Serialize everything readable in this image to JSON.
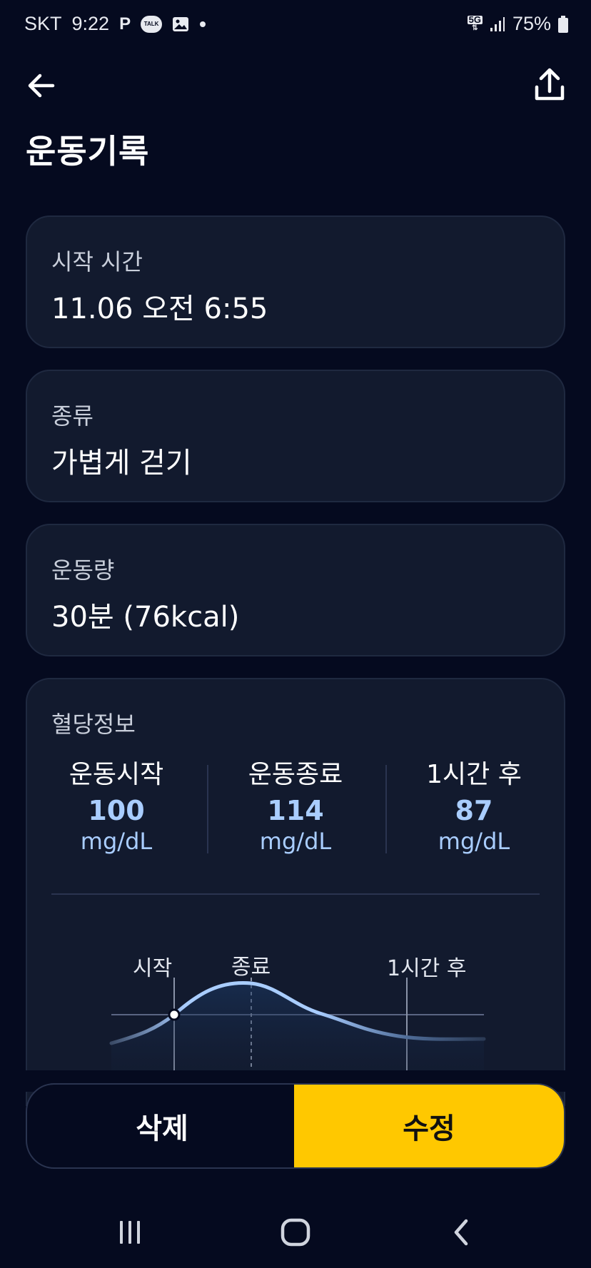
{
  "status_bar": {
    "carrier": "SKT",
    "time": "9:22",
    "p_icon_label": "P",
    "talk_label": "TALK",
    "network": "5G",
    "battery": "75%"
  },
  "header": {
    "title": "운동기록",
    "icons": {
      "back": "arrow-left-icon",
      "share": "share-upload-icon"
    }
  },
  "cards": {
    "start_time": {
      "label": "시작 시간",
      "value": "11.06 오전 6:55"
    },
    "type": {
      "label": "종류",
      "value": "가볍게 걷기"
    },
    "amount": {
      "label": "운동량",
      "value": "30분 (76kcal)"
    }
  },
  "blood_glucose": {
    "title": "혈당정보",
    "columns": [
      {
        "label": "운동시작",
        "value": "100",
        "unit": "mg/dL"
      },
      {
        "label": "운동종료",
        "value": "114",
        "unit": "mg/dL"
      },
      {
        "label": "1시간 후",
        "value": "87",
        "unit": "mg/dL"
      }
    ],
    "chart": {
      "markers": [
        "시작",
        "종료",
        "1시간 후"
      ],
      "line_color": "#a9cdff"
    }
  },
  "actions": {
    "delete_label": "삭제",
    "edit_label": "수정",
    "edit_color": "#ffc800"
  },
  "nav": {
    "recents": "recents-icon",
    "home": "home-icon",
    "back": "nav-back-icon"
  }
}
